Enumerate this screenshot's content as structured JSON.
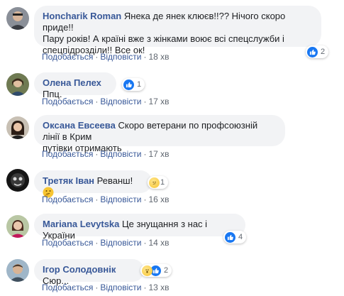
{
  "actions": {
    "like": "Подобається",
    "reply": "Відповісти",
    "sep": "·"
  },
  "colors": {
    "name": "#385898",
    "bubble": "#f2f3f5",
    "like": "#1877f2"
  },
  "comments": [
    {
      "author": "Honcharik Roman",
      "text_lines": [
        "Янека де янек клюєв!!?? Нічого скоро приде!!",
        "Пару років! А країні вже з жінками воює всі спецслужби і",
        "спецпідрозділи!! Все ок!"
      ],
      "time": "18 хв",
      "reactions": {
        "icons": [
          "like-icon"
        ],
        "count": "2"
      }
    },
    {
      "author": "Олена Пелех",
      "text_lines": [
        "Ппц."
      ],
      "time": "17 хв",
      "reactions": {
        "icons": [
          "like-icon"
        ],
        "count": "1"
      }
    },
    {
      "author": "Оксана Евсеева",
      "text_lines": [
        "Скоро ветерани по профсоюзній лінії в Крим",
        "путівки отримають"
      ],
      "time": "17 хв",
      "reactions": null
    },
    {
      "author": "Третяк Іван",
      "text_lines": [
        "Реванш!"
      ],
      "time": "16 хв",
      "reactions": {
        "icons": [
          "thinking-emoji-icon"
        ],
        "count": "1"
      }
    },
    {
      "author": "Mariana Levytska",
      "text_lines": [
        "Це знущання з нас і України"
      ],
      "time": "14 хв",
      "reactions": {
        "icons": [
          "like-icon"
        ],
        "count": "4"
      }
    },
    {
      "author": "Ігор Солодовнік",
      "text_lines": [
        "Сюр..."
      ],
      "time": "13 хв",
      "reactions": {
        "icons": [
          "like-icon",
          "wow-icon"
        ],
        "count": "2"
      }
    }
  ]
}
